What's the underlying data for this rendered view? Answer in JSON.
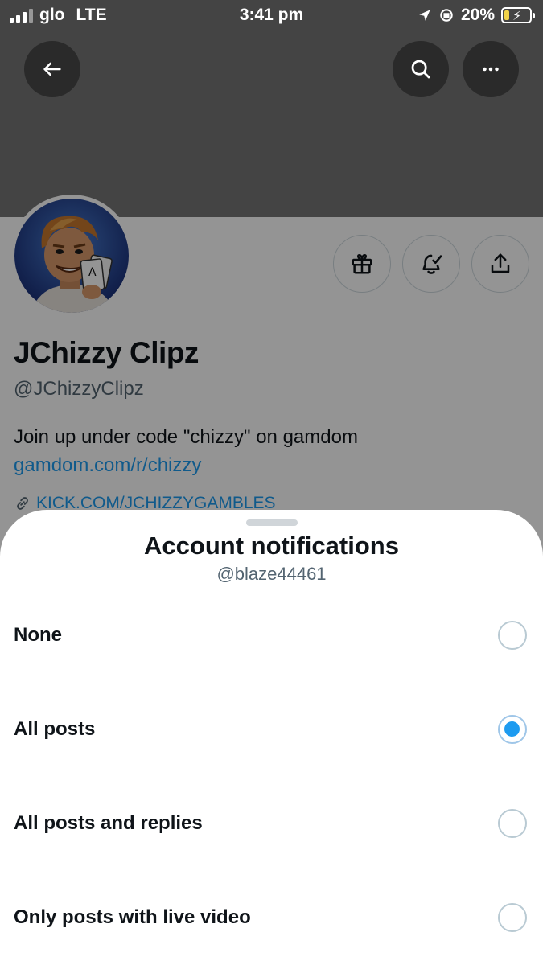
{
  "status_bar": {
    "carrier": "glo",
    "network": "LTE",
    "time": "3:41 pm",
    "battery_percent": "20%",
    "battery_level": 0.2,
    "battery_color": "#f0d34a"
  },
  "profile": {
    "display_name": "JChizzy Clipz",
    "handle": "@JChizzyClipz",
    "bio": "Join up under code \"chizzy\" on gamdom",
    "bio_link": "gamdom.com/r/chizzy",
    "website": "KICK.COM/JCHIZZYGAMBLES"
  },
  "icons": {
    "back": "arrow-left-icon",
    "search": "search-icon",
    "more": "more-horizontal-icon",
    "gift": "gift-icon",
    "bell": "bell-check-icon",
    "share": "share-icon",
    "link": "link-icon"
  },
  "sheet": {
    "title": "Account notifications",
    "subtitle": "@blaze44461",
    "options": [
      {
        "label": "None",
        "selected": false
      },
      {
        "label": "All posts",
        "selected": true
      },
      {
        "label": "All posts and replies",
        "selected": false
      },
      {
        "label": "Only posts with live video",
        "selected": false
      }
    ]
  },
  "colors": {
    "accent": "#1d9bf0",
    "text_primary": "#0f1419",
    "text_secondary": "#536471"
  }
}
